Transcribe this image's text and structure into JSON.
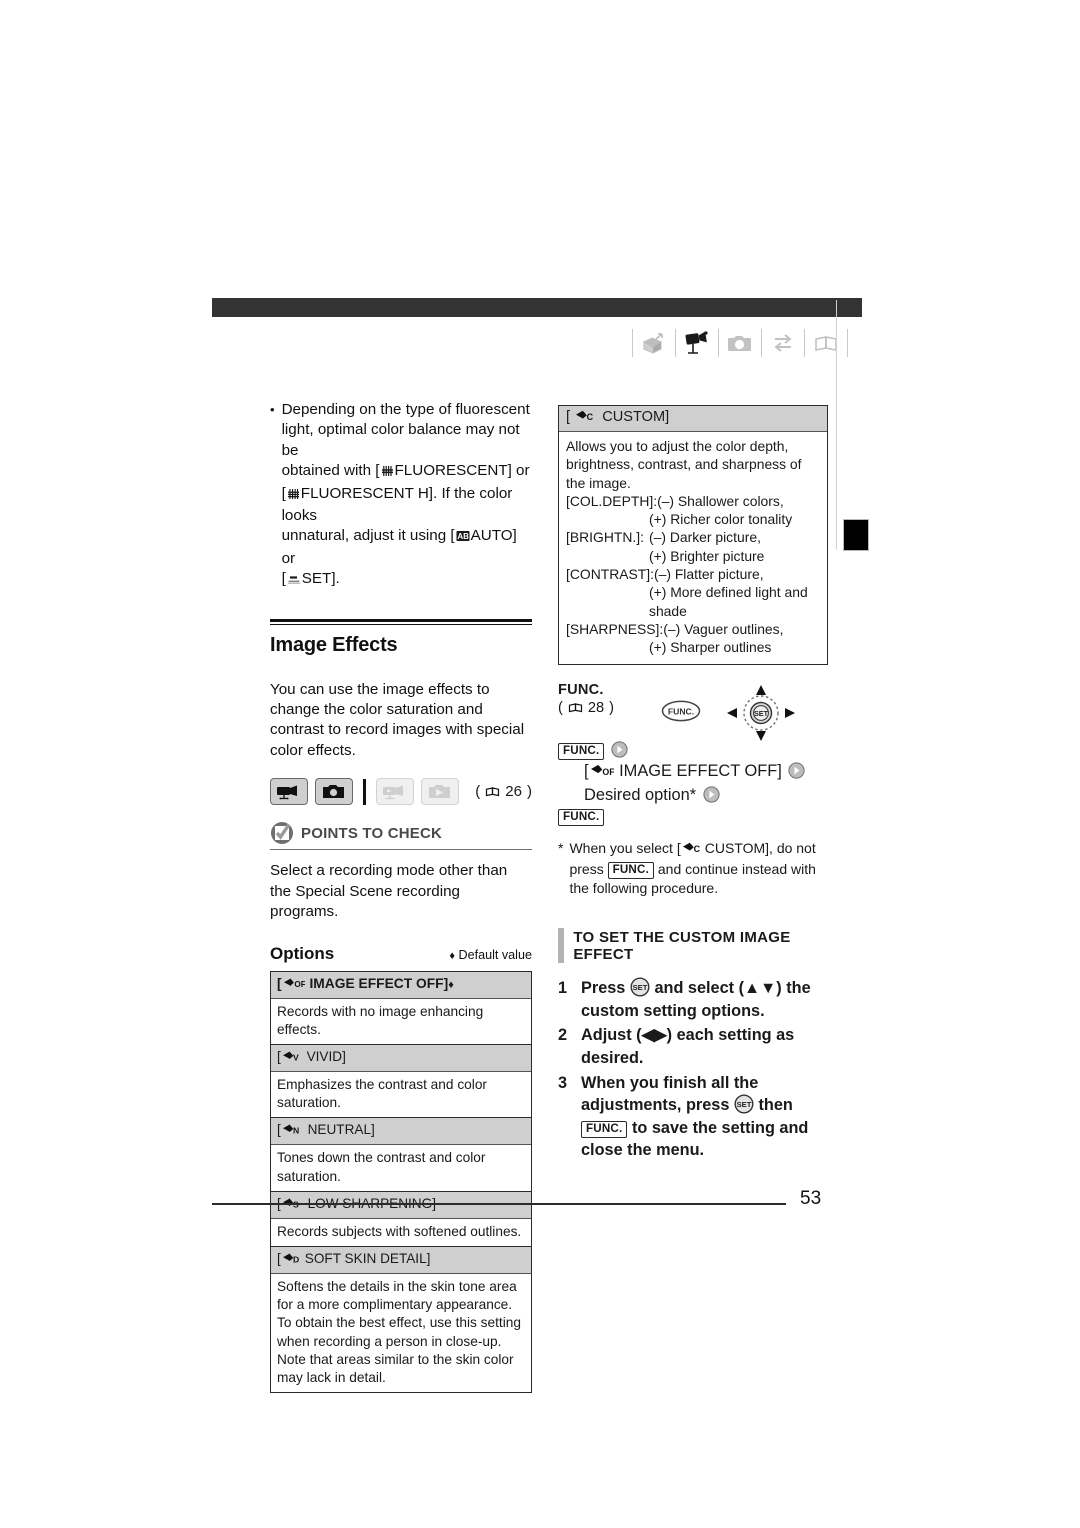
{
  "header": {
    "icons": [
      "print-icon",
      "camcorder-icon",
      "photo-camera-icon",
      "transfer-icon",
      "book-icon"
    ],
    "active_index": 1
  },
  "left_column": {
    "bullet": {
      "marker": "•",
      "lines": [
        "Depending on the type of fluorescent",
        "light, optimal color balance may not be",
        "obtained with [",
        "FLUORESCENT] or",
        "FLUORESCENT H]. If the color looks",
        "unnatural, adjust it using [",
        "AUTO] or",
        "SET]."
      ],
      "full_text": "Depending on the type of fluorescent light, optimal color balance may not be obtained with [ FLUORESCENT] or [ FLUORESCENT H]. If the color looks unnatural, adjust it using [ AUTO] or [ SET]."
    },
    "section_title": "Image Effects",
    "intro": "You can use the image effects to change the color saturation and contrast to record images with special color effects.",
    "modes": [
      {
        "name": "record-movie-mode",
        "icon": "camcorder-icon",
        "active": true
      },
      {
        "name": "record-still-mode",
        "icon": "photo-camera-icon",
        "active": true
      },
      {
        "name": "play-movie-mode",
        "icon": "play-movie-icon",
        "active": false
      },
      {
        "name": "play-still-mode",
        "icon": "play-still-icon",
        "active": false
      }
    ],
    "mode_ref": "26",
    "points_to_check": {
      "label": "POINTS TO CHECK",
      "body": "Select a recording mode other than the Special Scene recording programs."
    },
    "options_label": "Options",
    "default_value_note": "Default value",
    "default_marker": "♦",
    "options_table": [
      {
        "icon": "effect-off-icon",
        "header": "[ IMAGE EFFECT OFF]",
        "header_text": "IMAGE EFFECT OFF",
        "is_default": true,
        "bold": true,
        "desc": "Records with no image enhancing effects."
      },
      {
        "icon": "effect-vivid-icon",
        "header": "[ VIVID]",
        "header_text": "VIVID",
        "is_default": false,
        "bold": false,
        "desc": "Emphasizes the contrast and color saturation."
      },
      {
        "icon": "effect-neutral-icon",
        "header": "[ NEUTRAL]",
        "header_text": "NEUTRAL",
        "is_default": false,
        "bold": false,
        "desc": "Tones down the contrast and color saturation."
      },
      {
        "icon": "effect-low-sharpening-icon",
        "header": "[ LOW SHARPENING]",
        "header_text": "LOW SHARPENING",
        "is_default": false,
        "bold": false,
        "desc": "Records subjects with softened outlines."
      },
      {
        "icon": "effect-soft-skin-detail-icon",
        "header": "[ SOFT SKIN DETAIL]",
        "header_text": "SOFT SKIN DETAIL",
        "is_default": false,
        "bold": false,
        "desc": "Softens the details in the skin tone area for a more complimentary appearance. To obtain the best effect, use this setting when recording a person in close-up. Note that areas similar to the skin color may lack in detail."
      }
    ]
  },
  "right_column": {
    "custom_box": {
      "header": "[ CUSTOM]",
      "header_text": "CUSTOM",
      "icon": "effect-custom-icon",
      "intro": "Allows you to adjust the color depth, brightness, contrast, and sharpness of the image.",
      "rows": [
        {
          "key": "[COL.DEPTH]:",
          "minus": "(–) Shallower colors,",
          "plus": "(+) Richer color tonality"
        },
        {
          "key": "[BRIGHTN.]:",
          "minus": "(–) Darker picture,",
          "plus": "(+) Brighter picture"
        },
        {
          "key": "[CONTRAST]:",
          "minus": "(–) Flatter picture,",
          "plus": "(+) More defined light and shade"
        },
        {
          "key": "[SHARPNESS]:",
          "minus": "(–) Vaguer outlines,",
          "plus": "(+) Sharper outlines"
        }
      ]
    },
    "func": {
      "label": "FUNC.",
      "page_ref": "28",
      "button_icon": "func-button-icon",
      "joystick_icon": "joystick-set-icon",
      "steps": [
        {
          "key": "FUNC.",
          "text": "",
          "arrow": true,
          "indent": 0
        },
        {
          "key": "",
          "icon": "effect-off-icon",
          "text": "[ IMAGE EFFECT OFF]",
          "text_plain": "IMAGE EFFECT OFF",
          "arrow": true,
          "indent": 1
        },
        {
          "key": "",
          "text": "Desired option*",
          "arrow": true,
          "indent": 1
        },
        {
          "key": "FUNC.",
          "text": "",
          "arrow": false,
          "indent": 0
        }
      ]
    },
    "footnote": {
      "marker": "*",
      "text_a": "When you select [",
      "icon": "effect-custom-icon",
      "text_b": "CUSTOM], do not press",
      "key": "FUNC.",
      "text_c": "and continue instead with the following procedure."
    },
    "subheading": "TO SET THE CUSTOM IMAGE EFFECT",
    "numbered_steps": [
      {
        "n": "1",
        "a": "Press",
        "icon1": "set-button-icon",
        "b": "and select (",
        "dir": "▲▼",
        "c": ") the custom setting options."
      },
      {
        "n": "2",
        "a": "Adjust (",
        "dir": "◀▶",
        "c": ") each setting as desired."
      },
      {
        "n": "3",
        "a": "When you finish all the adjustments, press",
        "icon1": "set-button-icon",
        "b": "then",
        "key": "FUNC.",
        "c": "to save the setting and close the menu."
      }
    ]
  },
  "footer": {
    "page_number": "53"
  },
  "colors": {
    "topbar": "#333333",
    "table_header_bg": "#cfcfcf",
    "table_border": "#2b2b2b",
    "accent_grey": "#b3b3b3",
    "text": "#111111"
  }
}
